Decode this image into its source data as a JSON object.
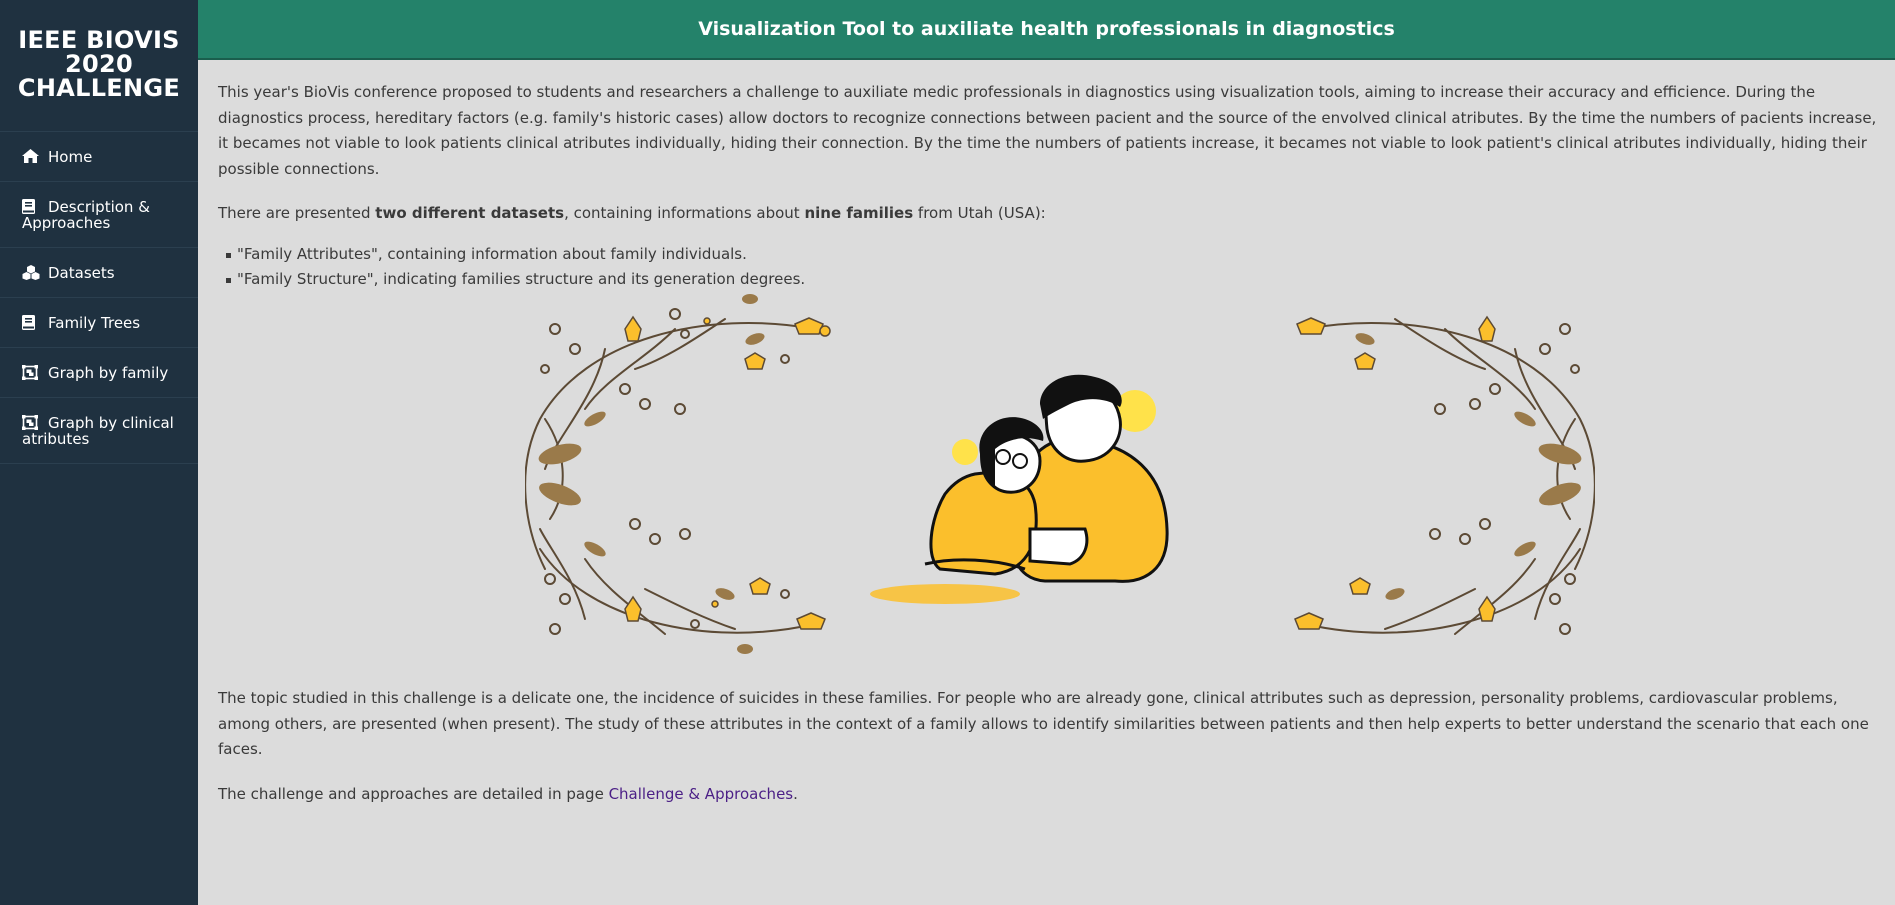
{
  "sidebar": {
    "brand": [
      "IEEE BIOVIS",
      "2020",
      "CHALLENGE"
    ],
    "items": [
      {
        "label": "Home",
        "icon": "home-icon"
      },
      {
        "label": "Description & Approaches",
        "icon": "book-icon"
      },
      {
        "label": "Datasets",
        "icon": "cubes-icon"
      },
      {
        "label": "Family Trees",
        "icon": "book-icon"
      },
      {
        "label": "Graph by family",
        "icon": "object-group-icon"
      },
      {
        "label": "Graph by clinical atributes",
        "icon": "object-group-icon"
      }
    ]
  },
  "header": {
    "title": "Visualization Tool to auxiliate health professionals in diagnostics"
  },
  "main": {
    "intro": "This year's BioVis conference proposed to students and researchers a challenge to auxiliate medic professionals in diagnostics using visualization tools, aiming to increase their accuracy and efficience. During the diagnostics process, hereditary factors (e.g. family's historic cases) allow doctors to recognize connections between pacient and the source of the envolved clinical atributes. By the time the numbers of pacients increase, it becames not viable to look patients clinical atributes individually, hiding their connection. By the time the numbers of patients increase, it becames not viable to look patient's clinical atributes individually, hiding their possible connections.",
    "datasets_pre": "There are presented ",
    "datasets_bold1": "two different datasets",
    "datasets_mid": ", containing informations about ",
    "datasets_bold2": "nine families",
    "datasets_post": " from Utah (USA):",
    "bullets": [
      "\"Family Attributes\", containing information about family individuals.",
      "\"Family Structure\", indicating families structure and its generation degrees."
    ],
    "topic": "The topic studied in this challenge is a delicate one, the incidence of suicides in these families. For people who are already gone, clinical attributes such as depression, personality problems, cardiovascular problems, among others, are presented (when present). The study of these attributes in the context of a family allows to identify similarities between patients and then help experts to better understand the scenario that each one faces.",
    "approach_pre": "The challenge and approaches are detailed in page ",
    "approach_link": "Challenge & Approaches",
    "approach_post": "."
  },
  "colors": {
    "sidebar_bg": "#1f3140",
    "header_bg": "#24826a",
    "page_bg": "#dcdcdc",
    "link": "#4b1f86",
    "illustration_yellow": "#fbbf2c"
  }
}
